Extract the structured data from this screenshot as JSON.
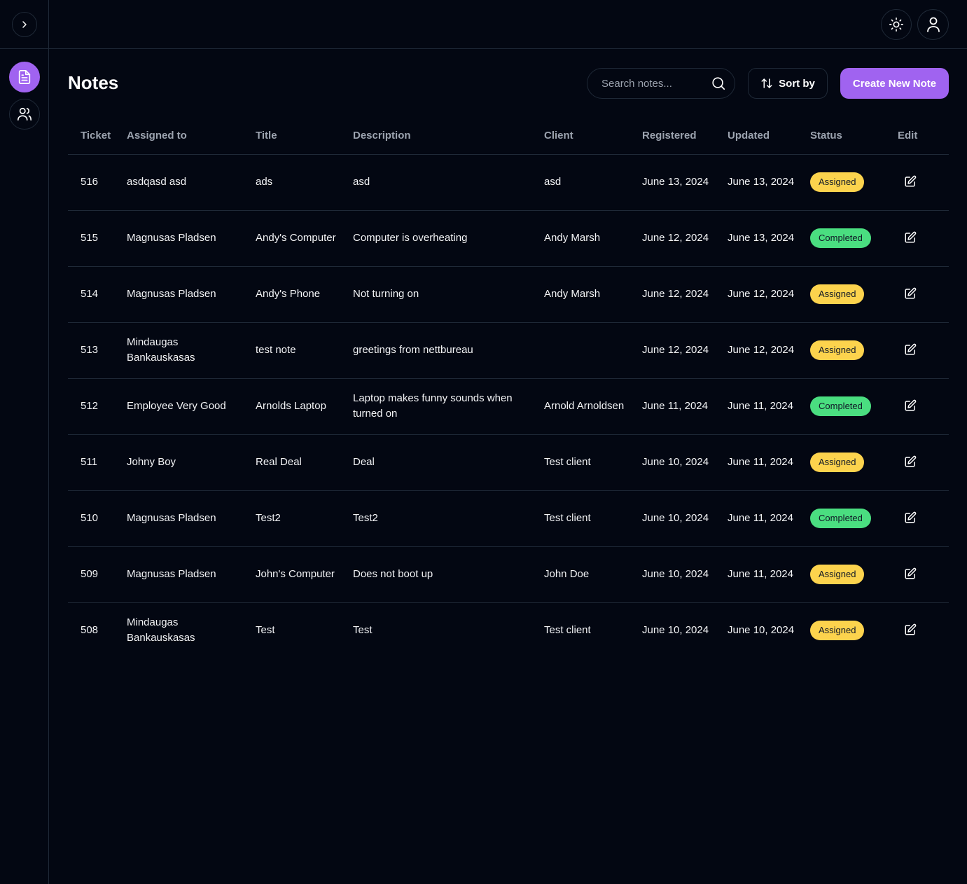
{
  "header": {
    "expand_icon": "chevron-right-icon",
    "theme_icon": "sun-icon",
    "user_icon": "user-icon"
  },
  "sidebar": {
    "items": [
      {
        "icon": "document-icon",
        "active": true
      },
      {
        "icon": "users-icon",
        "active": false
      }
    ]
  },
  "page": {
    "title": "Notes",
    "search_placeholder": "Search notes...",
    "sort_label": "Sort by",
    "create_label": "Create New Note"
  },
  "colors": {
    "background": "#030712",
    "accent": "#a063f0",
    "assigned": "#fcd34d",
    "completed": "#4ade80",
    "border": "#1f2937"
  },
  "table": {
    "columns": [
      "Ticket",
      "Assigned to",
      "Title",
      "Description",
      "Client",
      "Registered",
      "Updated",
      "Status",
      "Edit"
    ],
    "rows": [
      {
        "ticket": "516",
        "assigned": "asdqasd asd",
        "title": "ads",
        "description": "asd",
        "client": "asd",
        "registered": "June 13, 2024",
        "updated": "June 13, 2024",
        "status": "Assigned"
      },
      {
        "ticket": "515",
        "assigned": "Magnusas Pladsen",
        "title": "Andy's Computer",
        "description": "Computer is overheating",
        "client": "Andy Marsh",
        "registered": "June 12, 2024",
        "updated": "June 13, 2024",
        "status": "Completed"
      },
      {
        "ticket": "514",
        "assigned": "Magnusas Pladsen",
        "title": "Andy's Phone",
        "description": "Not turning on",
        "client": "Andy Marsh",
        "registered": "June 12, 2024",
        "updated": "June 12, 2024",
        "status": "Assigned"
      },
      {
        "ticket": "513",
        "assigned": "Mindaugas Bankauskasas",
        "title": "test note",
        "description": "greetings from nettbureau",
        "client": "",
        "registered": "June 12, 2024",
        "updated": "June 12, 2024",
        "status": "Assigned"
      },
      {
        "ticket": "512",
        "assigned": "Employee Very Good",
        "title": "Arnolds Laptop",
        "description": "Laptop makes funny sounds when turned on",
        "client": "Arnold Arnoldsen",
        "registered": "June 11, 2024",
        "updated": "June 11, 2024",
        "status": "Completed"
      },
      {
        "ticket": "511",
        "assigned": "Johny Boy",
        "title": "Real Deal",
        "description": "Deal",
        "client": "Test client",
        "registered": "June 10, 2024",
        "updated": "June 11, 2024",
        "status": "Assigned"
      },
      {
        "ticket": "510",
        "assigned": "Magnusas Pladsen",
        "title": "Test2",
        "description": "Test2",
        "client": "Test client",
        "registered": "June 10, 2024",
        "updated": "June 11, 2024",
        "status": "Completed"
      },
      {
        "ticket": "509",
        "assigned": "Magnusas Pladsen",
        "title": "John's Computer",
        "description": "Does not boot up",
        "client": "John Doe",
        "registered": "June 10, 2024",
        "updated": "June 11, 2024",
        "status": "Assigned"
      },
      {
        "ticket": "508",
        "assigned": "Mindaugas Bankauskasas",
        "title": "Test",
        "description": "Test",
        "client": "Test client",
        "registered": "June 10, 2024",
        "updated": "June 10, 2024",
        "status": "Assigned"
      }
    ]
  }
}
